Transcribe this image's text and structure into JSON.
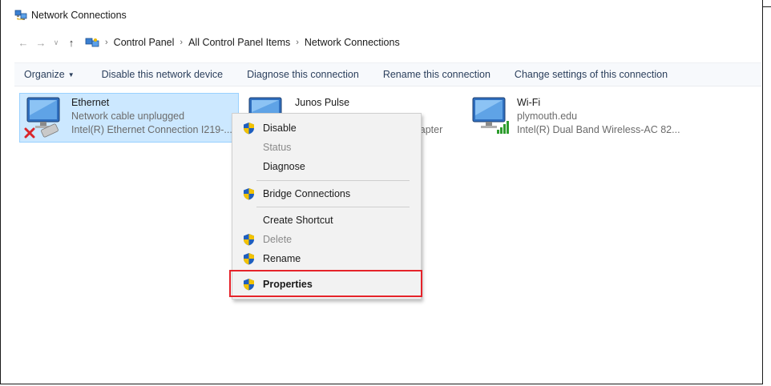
{
  "window": {
    "title": "Network Connections"
  },
  "nav": {
    "breadcrumb": [
      "Control Panel",
      "All Control Panel Items",
      "Network Connections"
    ]
  },
  "toolbar": {
    "organize": "Organize",
    "disable": "Disable this network device",
    "diagnose": "Diagnose this connection",
    "rename": "Rename this connection",
    "change": "Change settings of this connection"
  },
  "connections": {
    "ethernet": {
      "name": "Ethernet",
      "status": "Network cable unplugged",
      "device": "Intel(R) Ethernet Connection I219-..."
    },
    "junos": {
      "name": "Junos Pulse",
      "device_partial": "lapter"
    },
    "wifi": {
      "name": "Wi-Fi",
      "status": "plymouth.edu",
      "device": "Intel(R) Dual Band Wireless-AC 82..."
    }
  },
  "context_menu": {
    "disable": "Disable",
    "status": "Status",
    "diagnose": "Diagnose",
    "bridge": "Bridge Connections",
    "create_shortcut": "Create Shortcut",
    "delete": "Delete",
    "rename": "Rename",
    "properties": "Properties"
  },
  "colors": {
    "selection": "#cce8ff",
    "highlight_box": "#e5232a",
    "toolbar_text": "#2b3f5c"
  }
}
